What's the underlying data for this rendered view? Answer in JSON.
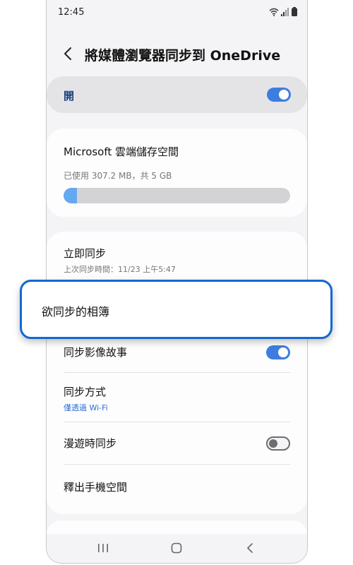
{
  "status_bar": {
    "time": "12:45"
  },
  "header": {
    "title": "將媒體瀏覽器同步到 OneDrive"
  },
  "master_switch": {
    "label": "開",
    "state": "on"
  },
  "storage": {
    "title": "Microsoft 雲端儲存空間",
    "used_text": "已使用 307.2 MB，共 5 GB",
    "used_fraction": 0.06
  },
  "settings": {
    "sync_now": {
      "title": "立即同步",
      "subtitle": "上次同步時間：11/23 上午5:47"
    },
    "albums": {
      "title": "欲同步的相簿"
    },
    "stories": {
      "title": "同步影像故事",
      "state": "on"
    },
    "method": {
      "title": "同步方式",
      "subtitle": "僅透過 Wi-Fi"
    },
    "roaming": {
      "title": "漫遊時同步",
      "state": "off"
    },
    "free_up": {
      "title": "釋出手機空間"
    }
  },
  "icons": {
    "back": "chevron-left-icon",
    "wifi": "wifi-icon",
    "signal": "signal-icon",
    "battery": "battery-icon",
    "recents": "recents-icon",
    "home": "home-icon",
    "nav_back": "nav-back-icon"
  },
  "colors": {
    "accent": "#3e7de0",
    "highlight_border": "#1268d3",
    "link_blue": "#2b6ad6",
    "bar_fill": "#64a8f0"
  }
}
